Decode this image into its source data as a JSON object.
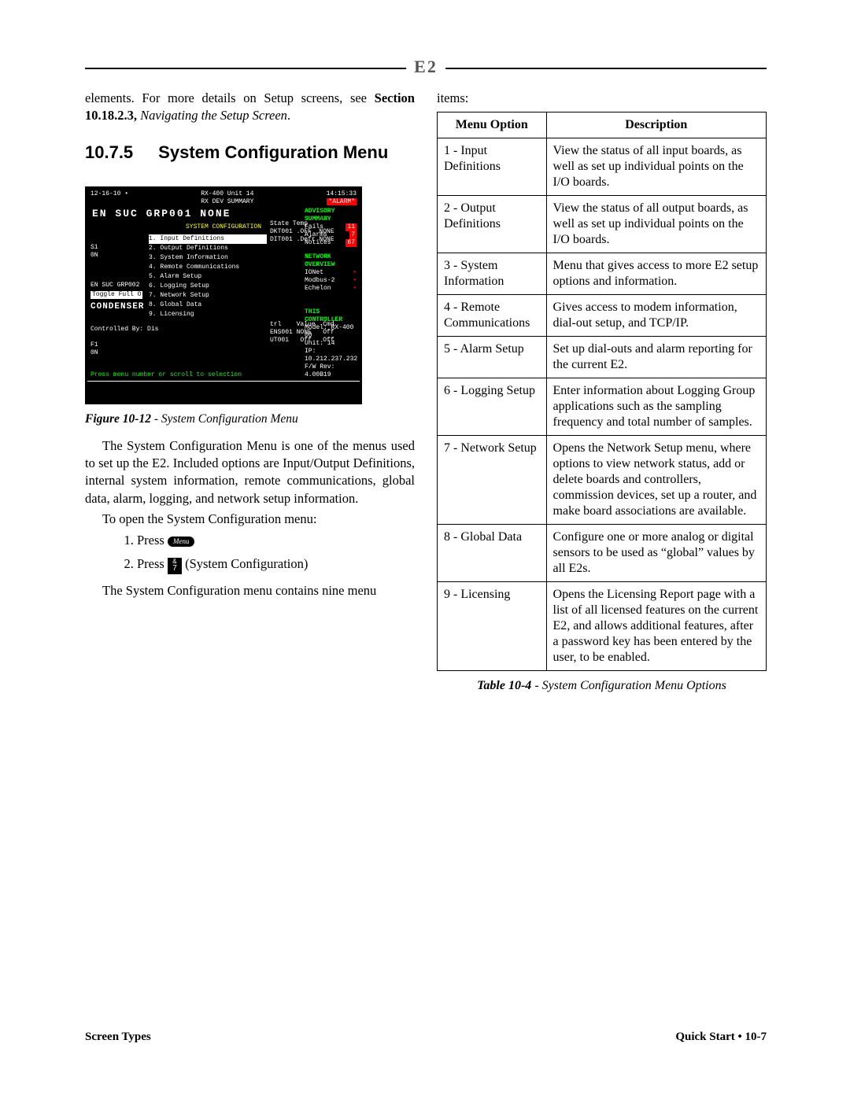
{
  "intro_para": "elements. For more details on Setup screens, see ",
  "crossref_section": "Section 10.18.2.3,",
  "crossref_title": " Navigating the Setup Screen",
  "crossref_end": ".",
  "heading_num": "10.7.5",
  "heading_title": "System Configuration Menu",
  "screenshot": {
    "date": "12-16-10 •",
    "title": "RX-400 Unit 14",
    "subtitle": "RX DEV SUMMARY",
    "time": "14:15:33",
    "alarm": "*ALARM*",
    "grp": "EN SUC GRP001  NONE",
    "menu_title": "SYSTEM CONFIGURATION",
    "menu": [
      "1.  Input Definitions",
      "2.  Output Definitions",
      "3.  System Information",
      "4.  Remote Communications",
      "5.  Alarm Setup",
      "6.  Logging Setup",
      "7.  Network Setup",
      "8.  Global Data",
      "9.  Licensing"
    ],
    "left_s1": "S1",
    "left_0n": "0N",
    "left_tag": "EN SUC GRP002",
    "left_btn": "Toggle Full O",
    "left_cond": "CONDENSER",
    "left_ctrl": "Controlled By: Dis",
    "left_f1": "F1",
    "left_0n2": "0N",
    "right_block1": "State Temp\nDKT001 .OFF  NONE\nDIT001 .Defr NONE",
    "advisory": "ADVISORY SUMMARY",
    "adv1": "Fails",
    "adv1v": "11",
    "adv2": "Alarms",
    "adv2v": "7",
    "adv3": "Notices",
    "adv3v": "67",
    "net_hdr": "NETWORK OVERVIEW",
    "net1": "IONet",
    "net2": "Modbus-2",
    "net3": "Echelon",
    "trl": "trl    Value  Cmd\nENS001 NONE   Off\nUT001   Off   Off",
    "ctrl_hdr": "THIS CONTROLLER",
    "ctrl1": "Model: RX-400  00",
    "ctrl2": "Unit: 14",
    "ctrl3": "IP: 10.212.237.232",
    "ctrl4": "F/W Rev: 4.00B19",
    "prompt": "Press menu number or scroll to selection"
  },
  "fig_label": "Figure 10-12",
  "fig_title": " - System Configuration Menu",
  "body1": "The System Configuration Menu is one of the menus used to set up the E2. Included options are Input/Output Definitions, internal system information, remote communications, global data, alarm, logging, and network setup information.",
  "open_line": "To open the System Configuration menu:",
  "step1_pre": "Press ",
  "key_menu": "Menu",
  "step2_pre": "Press ",
  "step2_post": " (System Configuration)",
  "key7_top": "&",
  "key7_bot": "7",
  "body2": "The System Configuration menu contains nine menu",
  "col2_lead": "items:",
  "table": {
    "hdr1": "Menu Option",
    "hdr2": "Description",
    "rows": [
      {
        "o": "1 - Input Definitions",
        "d": "View the status of all input boards, as well as set up individual points on the I/O boards."
      },
      {
        "o": "2 - Output Definitions",
        "d": "View the status of all output boards, as well as set up individual points on the I/O boards."
      },
      {
        "o": "3 - System Information",
        "d": "Menu that gives access to more E2 setup options and information."
      },
      {
        "o": "4 - Remote Communications",
        "d": "Gives access to modem information, dial-out setup, and TCP/IP."
      },
      {
        "o": "5 - Alarm Setup",
        "d": "Set up dial-outs and alarm reporting for the current E2."
      },
      {
        "o": "6 - Logging Setup",
        "d": "Enter information about Logging Group applications such as the sampling frequency and total number of samples."
      },
      {
        "o": "7 - Network Setup",
        "d": "Opens the Network Setup menu, where options to view network status, add or delete boards and controllers, commission devices, set up a router, and make board associations are available."
      },
      {
        "o": "8 - Global Data",
        "d": "Configure one or more analog or digital sensors to be used as “global” values by all E2s."
      },
      {
        "o": "9 - Licensing",
        "d": "Opens the Licensing Report page with a list of all licensed features on the current E2, and allows additional features, after a password key has been entered by the user, to be enabled."
      }
    ]
  },
  "table_label": "Table 10-4",
  "table_title": " - System Configuration Menu Options",
  "footer_left": "Screen Types",
  "footer_right1": "Quick Start • ",
  "footer_right2": "10-7"
}
